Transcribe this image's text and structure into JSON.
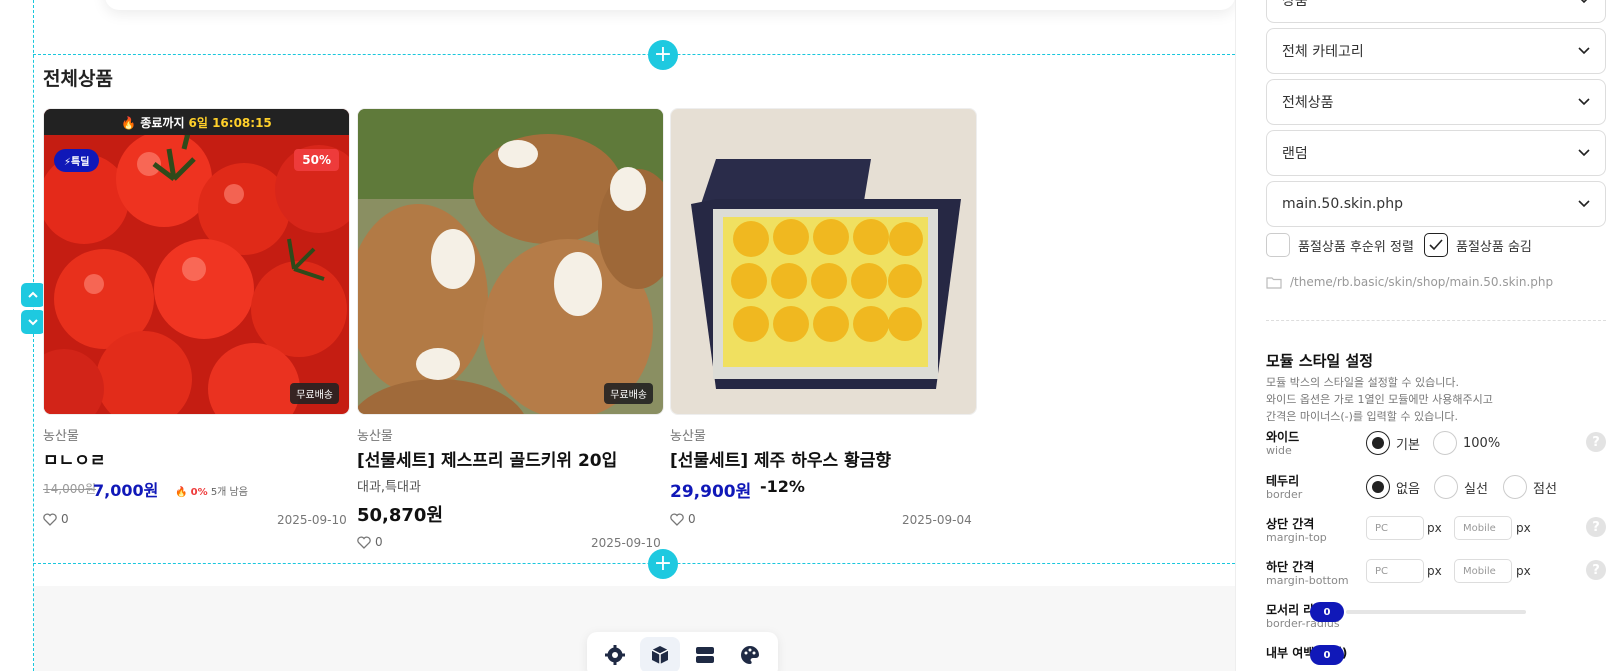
{
  "canvas": {
    "section_title": "전체상품",
    "add_section_glyph": "+",
    "move_up_glyph": "⌃",
    "move_down_glyph": "⌄"
  },
  "products": [
    {
      "category": "농산물",
      "name": "ㅁㄴㅇㄹ",
      "timer": {
        "prefix": "🔥 종료까지",
        "value": "6일 16:08:15"
      },
      "badge_deal": "⚡특딜",
      "badge_sale": "50%",
      "free_shipping": "무료배송",
      "price_original": "14,000원",
      "price": "7,000원",
      "stock_pct": "0%",
      "stock_text": "5개 남음",
      "likes": "0",
      "date": "2025-09-10"
    },
    {
      "category": "농산물",
      "name": "[선물세트] 제스프리 골드키위 20입",
      "options": "대과,특대과",
      "free_shipping": "무료배송",
      "price": "50,870원",
      "likes": "0",
      "date": "2025-09-10"
    },
    {
      "category": "농산물",
      "name": "[선물세트] 제주 하우스 황금향",
      "price": "29,900원",
      "discount": "-12%",
      "likes": "0",
      "date": "2025-09-04"
    }
  ],
  "toolbar": {
    "items": [
      "settings-icon",
      "box-icon",
      "layout-icon",
      "palette-icon"
    ],
    "active": "box-icon"
  },
  "panel": {
    "selects": [
      {
        "value": "상품"
      },
      {
        "value": "전체 카테고리"
      },
      {
        "value": "전체상품"
      },
      {
        "value": "랜덤"
      },
      {
        "value": "main.50.skin.php"
      }
    ],
    "checkbox_soldout_sort": {
      "label": "품절상품 후순위 정렬",
      "checked": false
    },
    "checkbox_soldout_hide": {
      "label": "품절상품 숨김",
      "checked": true
    },
    "skin_path": "/theme/rb.basic/skin/shop/main.50.skin.php",
    "style_title": "모듈 스타일 설정",
    "style_desc": [
      "모듈 박스의 스타일을 설정할 수 있습니다.",
      "와이드 옵션은 가로 1열인 모듈에만 사용해주시고",
      "간격은 마이너스(-)를 입력할 수 있습니다."
    ],
    "wide": {
      "label": "와이드",
      "sub": "wide",
      "options": [
        "기본",
        "100%"
      ],
      "selected": "기본"
    },
    "border": {
      "label": "테두리",
      "sub": "border",
      "options": [
        "없음",
        "실선",
        "점선"
      ],
      "selected": "없음"
    },
    "margin_top": {
      "label": "상단 간격",
      "sub": "margin-top",
      "pc_placeholder": "PC",
      "mobile_placeholder": "Mobile",
      "unit": "px"
    },
    "margin_bottom": {
      "label": "하단 간격",
      "sub": "margin-bottom",
      "pc_placeholder": "PC",
      "mobile_placeholder": "Mobile",
      "unit": "px"
    },
    "radius": {
      "label": "모서리 라운드",
      "sub": "border-radius",
      "value": "0"
    },
    "padding": {
      "label": "내부 여백(전체)",
      "value": "0"
    },
    "help_glyph": "?"
  }
}
